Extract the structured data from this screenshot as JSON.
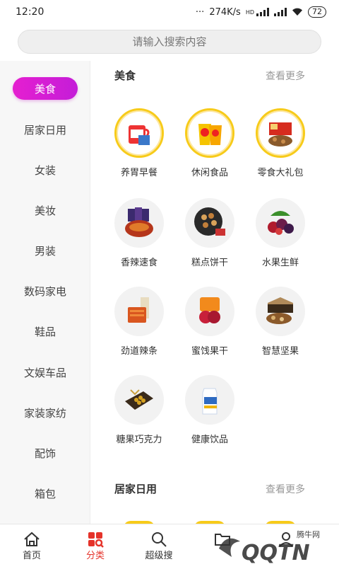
{
  "status": {
    "time": "12:20",
    "network_speed": "274K/s",
    "network_type": "HD",
    "battery": "72"
  },
  "search": {
    "placeholder": "请输入搜索内容"
  },
  "sidebar": {
    "items": [
      {
        "label": "美食",
        "active": true
      },
      {
        "label": "居家日用"
      },
      {
        "label": "女装"
      },
      {
        "label": "美妆"
      },
      {
        "label": "男装"
      },
      {
        "label": "数码家电"
      },
      {
        "label": "鞋品"
      },
      {
        "label": "文娱车品"
      },
      {
        "label": "家装家纺"
      },
      {
        "label": "配饰"
      },
      {
        "label": "箱包"
      }
    ]
  },
  "sections": [
    {
      "title": "美食",
      "more": "查看更多",
      "categories": [
        {
          "label": "养胃早餐",
          "icon": "breakfast-mug-icon"
        },
        {
          "label": "休闲食品",
          "icon": "chips-bag-icon"
        },
        {
          "label": "零食大礼包",
          "icon": "snack-gift-box-icon"
        },
        {
          "label": "香辣速食",
          "icon": "spicy-instant-food-icon"
        },
        {
          "label": "糕点饼干",
          "icon": "cookie-box-icon"
        },
        {
          "label": "水果生鲜",
          "icon": "fresh-fruit-icon"
        },
        {
          "label": "劲道辣条",
          "icon": "spicy-strip-icon"
        },
        {
          "label": "蜜饯果干",
          "icon": "dried-fruit-icon"
        },
        {
          "label": "智慧坚果",
          "icon": "nut-box-icon"
        },
        {
          "label": "糖果巧克力",
          "icon": "chocolate-box-icon"
        },
        {
          "label": "健康饮品",
          "icon": "drink-carton-icon"
        }
      ]
    },
    {
      "title": "居家日用",
      "more": "查看更多"
    }
  ],
  "bottom_nav": [
    {
      "label": "首页",
      "icon": "home-icon"
    },
    {
      "label": "分类",
      "icon": "category-icon",
      "active": true
    },
    {
      "label": "超级搜",
      "icon": "search-icon"
    },
    {
      "label": "",
      "icon": "folder-icon"
    },
    {
      "label": "",
      "icon": "profile-icon"
    }
  ],
  "watermark": {
    "brand": "腾牛网",
    "logo_text": "QQTN"
  },
  "colors": {
    "accent": "#e51fd0",
    "nav_active": "#e5332a",
    "ring": "#f7cb1a"
  }
}
